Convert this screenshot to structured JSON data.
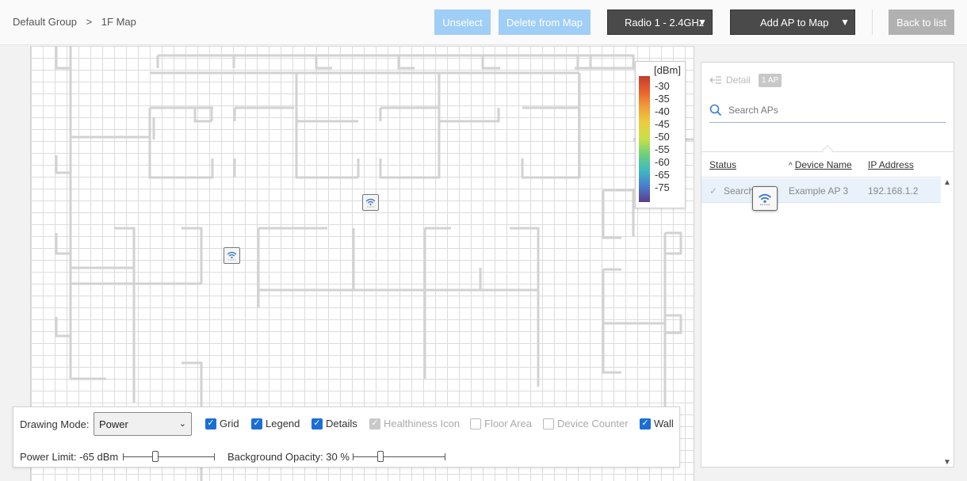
{
  "breadcrumb": {
    "group": "Default Group",
    "separator": ">",
    "page": "1F Map"
  },
  "toolbar": {
    "unselect": "Unselect",
    "delete_from_map": "Delete from Map",
    "radio_select": "Radio 1 - 2.4GHz",
    "add_ap": "Add AP to Map",
    "back_to_list": "Back to list",
    "caret": "▼"
  },
  "legend": {
    "unit": "[dBm]",
    "values": [
      "-30",
      "-35",
      "-40",
      "-45",
      "-50",
      "-55",
      "-60",
      "-65",
      "-75"
    ]
  },
  "controls": {
    "drawing_mode_label": "Drawing Mode:",
    "drawing_mode_value": "Power",
    "checkboxes": [
      {
        "label": "Grid",
        "checked": true,
        "enabled": true
      },
      {
        "label": "Legend",
        "checked": true,
        "enabled": true
      },
      {
        "label": "Details",
        "checked": true,
        "enabled": true
      },
      {
        "label": "Healthiness Icon",
        "checked": true,
        "enabled": false
      },
      {
        "label": "Floor Area",
        "checked": false,
        "enabled": false
      },
      {
        "label": "Device Counter",
        "checked": false,
        "enabled": false
      },
      {
        "label": "Wall",
        "checked": true,
        "enabled": true
      }
    ],
    "power_limit_label": "Power Limit: -65 dBm",
    "power_limit_level": 0.35,
    "bg_opacity_label": "Background Opacity: 30 %",
    "bg_opacity_level": 0.3
  },
  "panel": {
    "detail_label": "Detail",
    "ap_count_badge": "1 AP",
    "search_placeholder": "Search APs",
    "columns": {
      "status": "Status",
      "device_name": "Device Name",
      "ip_address": "IP Address"
    },
    "sort_indicator": "^",
    "rows": [
      {
        "status": "Search",
        "device_name": "Example AP 3",
        "ip_address": "192.168.1.2"
      }
    ]
  },
  "colors": {
    "accent": "#1a6fd6",
    "light_button": "#9fcef7",
    "dark_button": "#4a4a4a"
  }
}
